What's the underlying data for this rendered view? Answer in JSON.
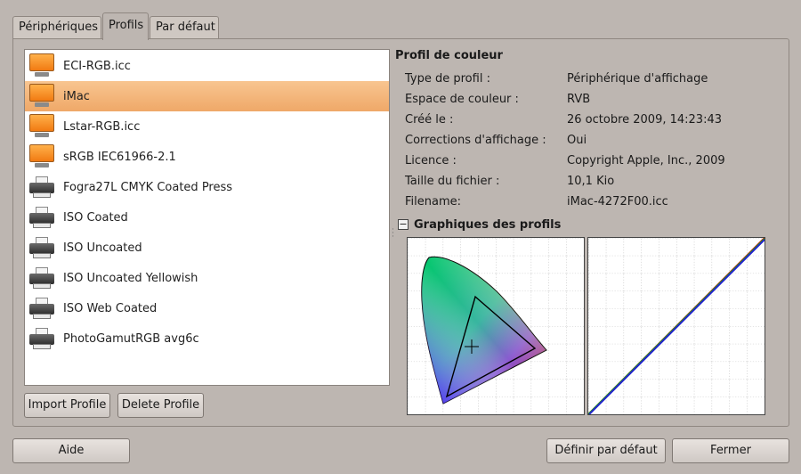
{
  "tabs": [
    {
      "label": "Périphériques"
    },
    {
      "label": "Profils"
    },
    {
      "label": "Par défaut"
    }
  ],
  "profiles": [
    {
      "name": "ECI-RGB.icc",
      "icon": "monitor-icon",
      "selected": false
    },
    {
      "name": "iMac",
      "icon": "monitor-icon",
      "selected": true
    },
    {
      "name": "Lstar-RGB.icc",
      "icon": "monitor-icon",
      "selected": false
    },
    {
      "name": "sRGB IEC61966-2.1",
      "icon": "monitor-icon",
      "selected": false
    },
    {
      "name": "Fogra27L CMYK Coated Press",
      "icon": "printer-icon",
      "selected": false
    },
    {
      "name": "ISO Coated",
      "icon": "printer-icon",
      "selected": false
    },
    {
      "name": "ISO Uncoated",
      "icon": "printer-icon",
      "selected": false
    },
    {
      "name": "ISO Uncoated Yellowish",
      "icon": "printer-icon",
      "selected": false
    },
    {
      "name": "ISO Web Coated",
      "icon": "printer-icon",
      "selected": false
    },
    {
      "name": "PhotoGamutRGB avg6c",
      "icon": "printer-icon",
      "selected": false
    }
  ],
  "buttons": {
    "import": "Import Profile",
    "delete": "Delete Profile",
    "help": "Aide",
    "set_default": "Définir par défaut",
    "close": "Fermer"
  },
  "details": {
    "title": "Profil de couleur",
    "rows": [
      {
        "label": "Type de profil :",
        "value": "Périphérique d'affichage"
      },
      {
        "label": "Espace de couleur :",
        "value": "RVB"
      },
      {
        "label": "Créé le :",
        "value": "26 octobre 2009, 14:23:43"
      },
      {
        "label": "Corrections d'affichage :",
        "value": "Oui"
      },
      {
        "label": "Licence :",
        "value": "Copyright Apple, Inc., 2009"
      },
      {
        "label": "Taille du fichier :",
        "value": "10,1 Kio"
      },
      {
        "label": "Filename:",
        "value": "iMac-4272F00.icc"
      }
    ]
  },
  "graphs": {
    "title": "Graphiques des profils",
    "expander_symbol": "−"
  },
  "colors": {
    "selection": "#f5b77a",
    "window_bg": "#bdb6b1",
    "monitor_orange": "#f58a1f"
  }
}
